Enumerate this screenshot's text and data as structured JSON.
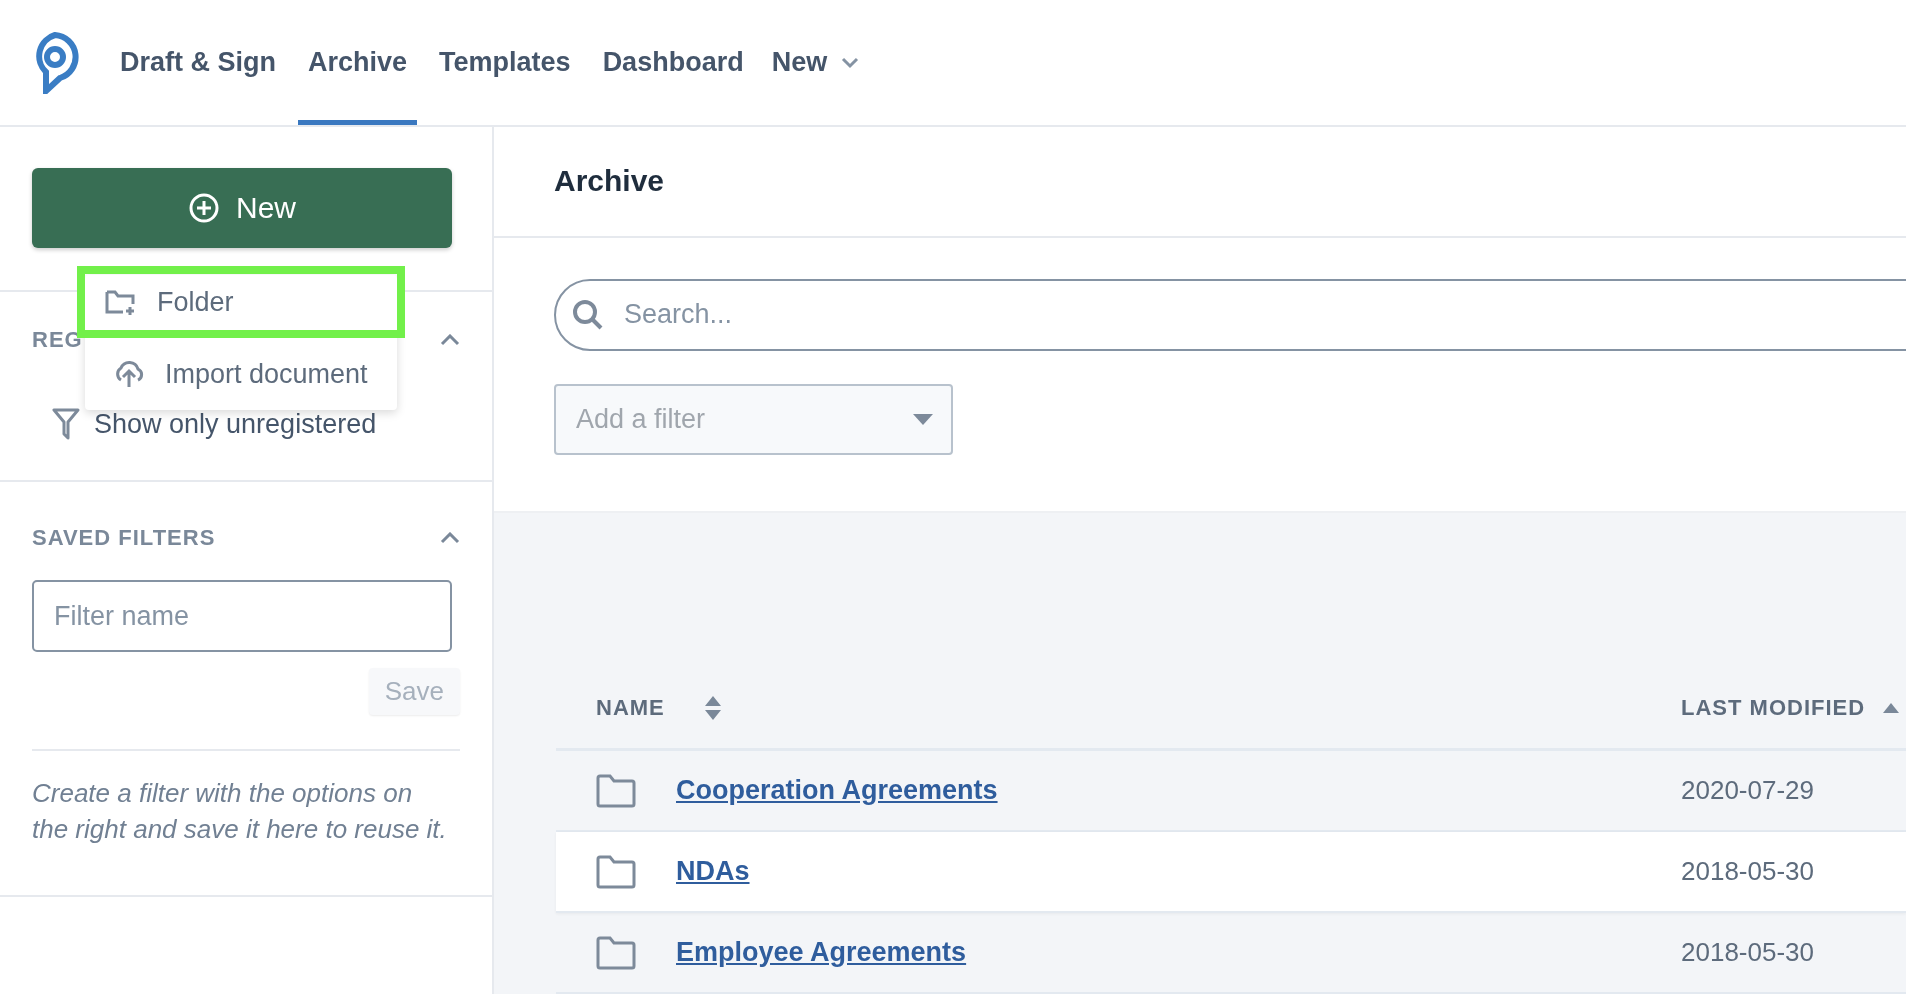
{
  "nav": {
    "items": [
      {
        "label": "Draft & Sign",
        "selected": false
      },
      {
        "label": "Archive",
        "selected": true
      },
      {
        "label": "Templates",
        "selected": false
      },
      {
        "label": "Dashboard",
        "selected": false
      }
    ],
    "menu": {
      "label": "New"
    }
  },
  "sidebar": {
    "new_button": {
      "label": "New"
    },
    "new_menu": {
      "items": [
        {
          "kind": "folder",
          "label": "Folder",
          "selected": true
        },
        {
          "kind": "import",
          "label": "Import document",
          "selected": false
        }
      ]
    },
    "register_section": {
      "title": "REG",
      "expanded": true,
      "filter_label": "Show only unregistered"
    },
    "saved_filters": {
      "title": "SAVED FILTERS",
      "expanded": true,
      "placeholder": "Filter name",
      "save_button": "Save",
      "hint": "Create a filter with the options on the right and save it here to reuse it."
    }
  },
  "main": {
    "title": "Archive",
    "search": {
      "placeholder": "Search..."
    },
    "filter": {
      "placeholder": "Add a filter"
    },
    "table": {
      "columns": [
        {
          "label": "NAME",
          "sorted": false
        },
        {
          "label": "LAST MODIFIED",
          "sorted": true
        }
      ],
      "rows": [
        {
          "name": "Cooperation Agreements",
          "modified": "2020-07-29",
          "hovered": false
        },
        {
          "name": "NDAs",
          "modified": "2018-05-30",
          "hovered": true
        },
        {
          "name": "Employee Agreements",
          "modified": "2018-05-30",
          "hovered": false
        }
      ]
    }
  }
}
